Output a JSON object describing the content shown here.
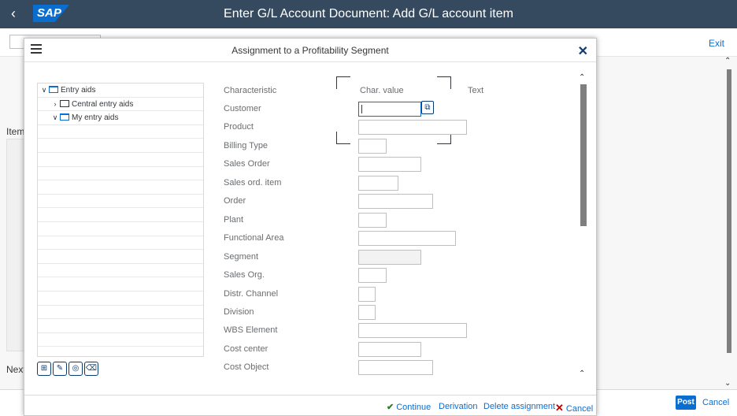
{
  "shell": {
    "back_icon": "‹",
    "logo": "SAP",
    "title": "Enter G/L Account Document: Add G/L account item"
  },
  "background": {
    "exit_label": "Exit",
    "item_label": "Item",
    "next_label": "Next",
    "post_label": "Post",
    "cancel_label": "Cancel"
  },
  "dialog": {
    "title": "Assignment to a Profitability Segment",
    "close_icon": "✕",
    "tree": [
      {
        "arrow": "∨",
        "label": "Entry aids",
        "indent": 0,
        "folder": "open"
      },
      {
        "arrow": "›",
        "label": "Central entry aids",
        "indent": 1,
        "folder": "closed"
      },
      {
        "arrow": "∨",
        "label": "My entry aids",
        "indent": 1,
        "folder": "open"
      }
    ],
    "columns": {
      "characteristic": "Characteristic",
      "char_value": "Char. value",
      "text": "Text"
    },
    "rows": [
      {
        "label": "Customer",
        "width": 80,
        "focus": true
      },
      {
        "label": "Product",
        "width": 138
      },
      {
        "label": "Billing Type",
        "width": 36
      },
      {
        "label": "Sales Order",
        "width": 80
      },
      {
        "label": "Sales ord. item",
        "width": 51
      },
      {
        "label": "Order",
        "width": 95
      },
      {
        "label": "Plant",
        "width": 36
      },
      {
        "label": "Functional Area",
        "width": 124
      },
      {
        "label": "Segment",
        "width": 80,
        "readonly": true
      },
      {
        "label": "Sales Org.",
        "width": 36
      },
      {
        "label": "Distr. Channel",
        "width": 22
      },
      {
        "label": "Division",
        "width": 22
      },
      {
        "label": "WBS Element",
        "width": 138
      },
      {
        "label": "Cost center",
        "width": 80
      },
      {
        "label": "Cost Object",
        "width": 95
      }
    ],
    "actions": {
      "continue": "Continue",
      "derivation": "Derivation",
      "delete_assignment": "Delete assignment",
      "cancel": "Cancel"
    }
  }
}
